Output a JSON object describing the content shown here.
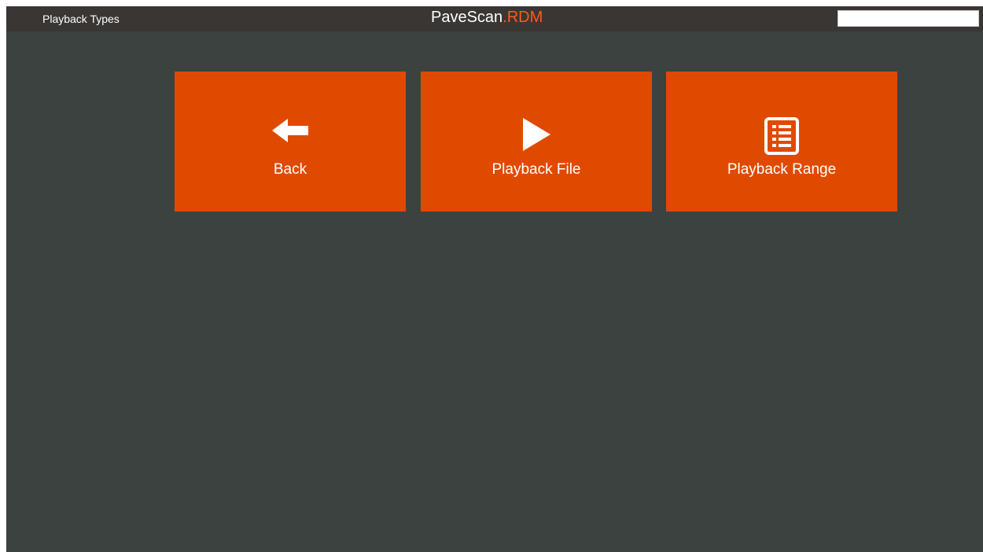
{
  "header": {
    "title": "Playback Types",
    "logo": {
      "main": "PaveScan",
      "dot": ".",
      "accent": "RDM"
    },
    "search": {
      "value": "",
      "placeholder": ""
    }
  },
  "tiles": [
    {
      "label": "Back",
      "icon": "arrow-left-icon"
    },
    {
      "label": "Playback File",
      "icon": "play-icon"
    },
    {
      "label": "Playback Range",
      "icon": "list-icon"
    }
  ],
  "colors": {
    "background": "#3c4240",
    "topbar": "#3a3634",
    "tile": "#e04a00",
    "accent": "#ff5a1a",
    "text": "#ffffff"
  }
}
